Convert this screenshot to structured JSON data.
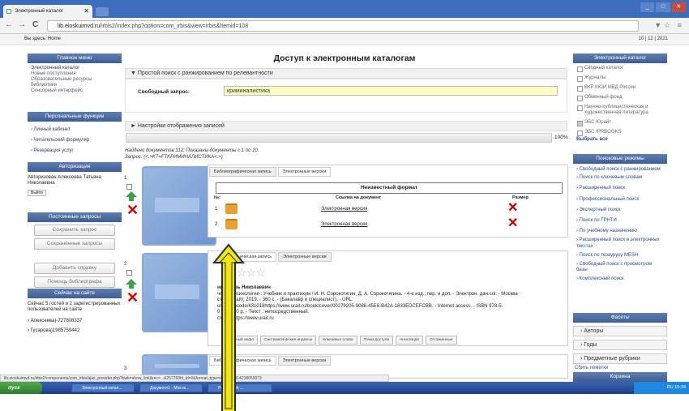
{
  "browser": {
    "tab_title": "Электронный каталог",
    "tab_close": "✕",
    "url_host": "lib.eioskuimvd.ru",
    "url_path": "/irbis2/index.php?option=com_irbis&view=irbis&Itemid=108",
    "window_buttons": [
      "_",
      "□",
      "✕"
    ],
    "nav_back": "←",
    "nav_forward": "→",
    "nav_reload": "C",
    "tools": "▼☆ ≡"
  },
  "breadcrumb": "Вы здесь: Home",
  "date": "10 | 12 | 2021",
  "left": {
    "main_menu_title": "Главное меню",
    "main_menu": [
      "Электронный каталог",
      "Новые поступления",
      "Образовательные ресурсы библиотеки",
      "Сенсорный интерфейс"
    ],
    "personal_title": "Персональные функции",
    "personal": [
      "› Личный кабинет",
      "› Читательский формуляр",
      "› Резервация услуг"
    ],
    "auth_title": "Авторизация",
    "auth_text": "Авторизован Алексеева Татьяна Николаевна",
    "logout": "Выйти",
    "queries_title": "Постоянные запросы",
    "save_query": "Сохранить запрос",
    "saved_queries": "Сохранённые запросы",
    "add_ref": "Добавить справку",
    "help": "Помощь библиографа",
    "online_title": "Сейчас на сайте",
    "online_text": "Сейчас 5 гостей и 2 зарегистрированных пользователей на сайте",
    "online_users": [
      "› Алексеева)-727808337",
      "› Гусарова)1985759442"
    ]
  },
  "center": {
    "title": "Доступ к электронным каталогам",
    "simple_search": "▼ Простой поиск с ранжированием по релевантности",
    "query_label": "Свободный запрос:",
    "query_value": "криминалистика",
    "display_settings": "► Настройки отображения записей",
    "progress_pct": "100%",
    "progress_value": 1.0,
    "found_line1": "Найдено документов:312; Показаны документы с 1 по 10.",
    "found_line2": "Запрос: (<.>K7=FTKРИМИНАЛИСТИКА<.>)",
    "tab_biblio": "Библиографическая запись",
    "tab_biblio_short": "ическая запись",
    "tab_electronic": "Электронные версии",
    "unknown_format": "Неизвестный формат",
    "col_no": "№:",
    "col_link": "Ссылка на документ",
    "col_size": "Размер",
    "rows": [
      {
        "no": "1",
        "link": "Электронная версия"
      },
      {
        "no": "2",
        "link": "Электронная версия"
      }
    ],
    "record_nums": [
      "1",
      "2",
      "3"
    ],
    "stars": "☆☆☆",
    "biblio_lines": [
      "ни, Игорь Николаевич",
      "ческая психология : Учебник и практикум / И. Н. Сорокотягин, Д. А. Сорокотягина. - 4-е изд., пер. и доп. - Электрон. дан.col. - Москва :",
      "ство Юрайт, 2019. - 360 с. - (Бакалавр и специалист). - URL:",
      "urait.ru/bcode/431018https://www.urait.ru/book/cover/00279205-9086-45E6-B42A-1833EDCEFCBB. - Internet access. - ISBN 978-5-",
      "0 : 849.00 р. - Текст : непосредственный.",
      "ступа: https://www.urait.ru"
    ],
    "record_buttons": [
      "полный инфо",
      "Систематические индексы",
      "Ключевые слова",
      "Точки доступа",
      "Аннотация",
      "Отложенные"
    ]
  },
  "right": {
    "catalog_title": "Электронный каталог",
    "catalogs": [
      {
        "label": "Сводный каталог",
        "checked": false
      },
      {
        "label": "Журналы",
        "checked": false
      },
      {
        "label": "ВКР КЮИ МВД России",
        "checked": false
      },
      {
        "label": "Обменный фонд",
        "checked": false
      },
      {
        "label": "Научно-публицистическая и художественная литература",
        "checked": false
      },
      {
        "label": "ЭБС Юрайт",
        "checked": true
      },
      {
        "label": "ЭБС IPRBOOKS",
        "checked": false
      }
    ],
    "select_all": "Выбрать все",
    "modes_title": "Поисковые режимы",
    "modes": [
      "› Свободный поиск с ранжированием",
      "› Поиск по ключевым словам",
      "› Расширенный поиск",
      "› Профессиональный поиск",
      "› Экспертный поиск",
      "› Поиск по ГРНТИ",
      "› По учебному назначению",
      "› Расширенный поиск в электронных текстах",
      "› Поиск по тезаурусу MESH",
      "› Свободный поиск с просмотром базы",
      "› Комплексный поиск"
    ],
    "facets_title": "Фасеты",
    "facets": [
      "› Авторы",
      "› Годы",
      "› Предметные рубрики"
    ],
    "reset": "Сбить пометки",
    "cover_title": "Корзина"
  },
  "status_url": "lib.eioskuimvd.ru/irbis2/components/com_irbis/ajax_provider.php?task=show_link&rec=...&257766bl_id=0&format_type=id&=163914218659073",
  "taskbar": {
    "start": "пуск",
    "buttons": [
      "Электронный катал...",
      "Документ1 - Micros...",
      "PowerPoint ..."
    ],
    "tray": "RU   15:34"
  },
  "colors": {
    "header_blue": "#4a6aa5",
    "highlight": "#ffffc4",
    "arrow": "#f5e600"
  }
}
